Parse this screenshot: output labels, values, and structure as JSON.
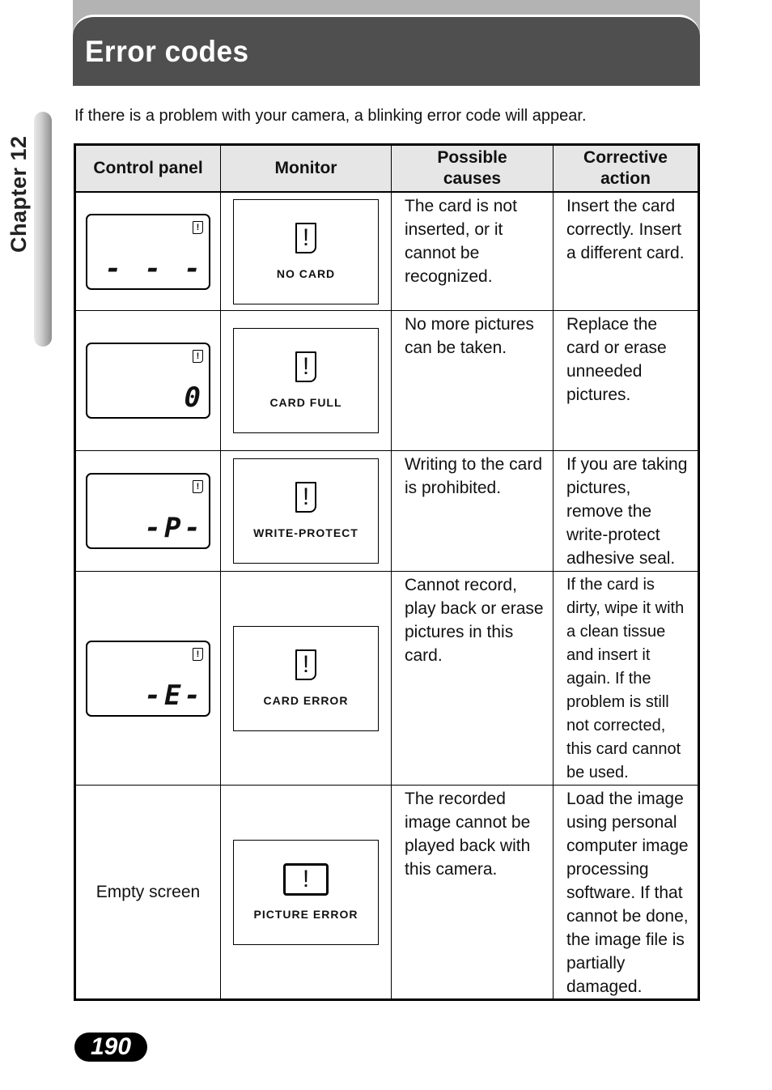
{
  "header": {
    "title": "Error codes"
  },
  "chapter": {
    "label": "Chapter 12"
  },
  "intro": "If there is a problem with your camera, a blinking error code will appear.",
  "table": {
    "columns": [
      "Control panel",
      "Monitor",
      "Possible causes",
      "Corrective action"
    ],
    "rows": [
      {
        "panel_code": "- - -",
        "panel_icon": "!",
        "monitor_icon": "!",
        "monitor_label": "NO  CARD",
        "cause": "The card is not inserted, or it cannot be recognized.",
        "action": "Insert the card correctly. Insert a different card."
      },
      {
        "panel_code": "0",
        "panel_icon": "!",
        "monitor_icon": "!",
        "monitor_label": "CARD  FULL",
        "cause": "No more pictures can be taken.",
        "action": "Replace the card or erase unneeded pictures."
      },
      {
        "panel_code": "-P-",
        "panel_icon": "!",
        "monitor_icon": "!",
        "monitor_label": "WRITE-PROTECT",
        "cause": "Writing to the card is prohibited.",
        "action": "If you are taking pictures, remove the write-protect adhesive seal."
      },
      {
        "panel_code": "-E-",
        "panel_icon": "!",
        "monitor_icon": "!",
        "monitor_label": "CARD  ERROR",
        "cause": "Cannot record, play back or erase pictures in this card.",
        "action": "If the card is dirty, wipe it with a clean tissue and insert it again. If the problem is still not corrected, this card cannot be used."
      },
      {
        "panel_text": "Empty screen",
        "monitor_icon": "!",
        "monitor_label": "PICTURE  ERROR",
        "cause": "The recorded image cannot be played back with this camera.",
        "action": "Load the image using personal computer image processing software.  If that cannot be done, the image file is partially damaged."
      }
    ]
  },
  "page_number": "190"
}
